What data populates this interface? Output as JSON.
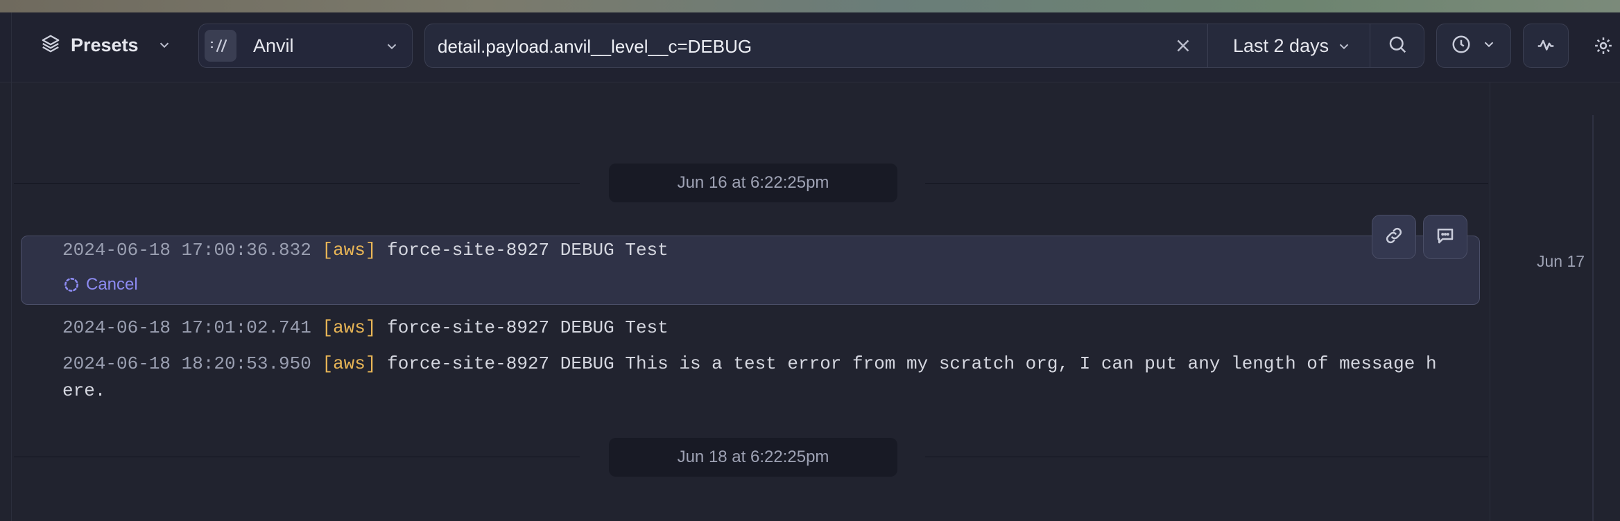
{
  "toolbar": {
    "presets_label": "Presets",
    "source_label": "Anvil",
    "query_value": "detail.payload.anvil__level__c=DEBUG",
    "time_range_label": "Last 2 days"
  },
  "icons": [
    "layers-icon",
    "chevron-down-icon",
    "anvil-logo-icon",
    "clear-icon",
    "search-icon",
    "clock-icon",
    "pulse-icon",
    "gear-icon",
    "link-icon",
    "comment-icon",
    "spinner-icon"
  ],
  "dividers": {
    "top": "Jun 16 at 6:22:25pm",
    "bottom": "Jun 18 at 6:22:25pm"
  },
  "logs": [
    {
      "timestamp": "2024-06-18 17:00:36.832",
      "source": "[aws]",
      "message": "force-site-8927 DEBUG Test"
    },
    {
      "timestamp": "2024-06-18 17:01:02.741",
      "source": "[aws]",
      "message": "force-site-8927 DEBUG Test"
    },
    {
      "timestamp": "2024-06-18 18:20:53.950",
      "source": "[aws]",
      "message": "force-site-8927 DEBUG This is a test error from my scratch org, I can put any length of message h",
      "message_cont": "ere."
    }
  ],
  "selected_action": {
    "cancel_label": "Cancel"
  },
  "side": {
    "date_label": "Jun 17"
  },
  "colors": {
    "background": "#21232f",
    "accent": "#8d8bf2",
    "source": "#e8b556"
  }
}
